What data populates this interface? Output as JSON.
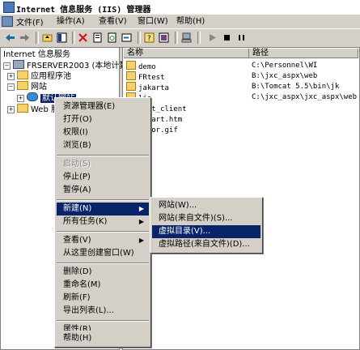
{
  "window": {
    "title": "Internet 信息服务 (IIS) 管理器"
  },
  "menubar": {
    "items": [
      "文件(F)",
      "操作(A)",
      "查看(V)",
      "窗口(W)",
      "帮助(H)"
    ]
  },
  "tree": {
    "root": "Internet 信息服务",
    "server": "FRSERVER2003 (本地计算机)",
    "apppool": "应用程序池",
    "websites": "网站",
    "default_site": "默认网站",
    "web_ext": "Web 服"
  },
  "list": {
    "headers": {
      "name": "名称",
      "path": "路径"
    },
    "rows": [
      {
        "name": "demo",
        "path": "C:\\Personnel\\WI"
      },
      {
        "name": "FRtest",
        "path": "B:\\jxc_aspx\\web"
      },
      {
        "name": "jakarta",
        "path": "B:\\Tomcat 5.5\\bin\\jk"
      },
      {
        "name": "lie",
        "path": "C:\\jxc_aspx\\jxc_aspx\\web"
      },
      {
        "name": "pnet_client",
        "path": ""
      },
      {
        "name": "tstart.htm",
        "path": ""
      },
      {
        "name": "error.gif",
        "path": ""
      }
    ]
  },
  "context_menu": {
    "explorer": "资源管理器(E)",
    "open": "打开(O)",
    "permissions": "权限(I)",
    "browse": "浏览(B)",
    "start": "启动(S)",
    "stop": "停止(P)",
    "pause": "暂停(A)",
    "new": "新建(N)",
    "all_tasks": "所有任务(K)",
    "view": "查看(V)",
    "new_window": "从这里创建窗口(W)",
    "delete": "删除(D)",
    "rename": "重命名(M)",
    "refresh": "刷新(F)",
    "export": "导出列表(L)...",
    "properties": "属性(R)",
    "help": "帮助(H)"
  },
  "submenu": {
    "website": "网站(W)...",
    "website_from_file": "网站(来自文件)(S)...",
    "virtual_dir": "虚拟目录(V)...",
    "virtual_dir_from_file": "虚拟路径(来自文件)(D)..."
  }
}
